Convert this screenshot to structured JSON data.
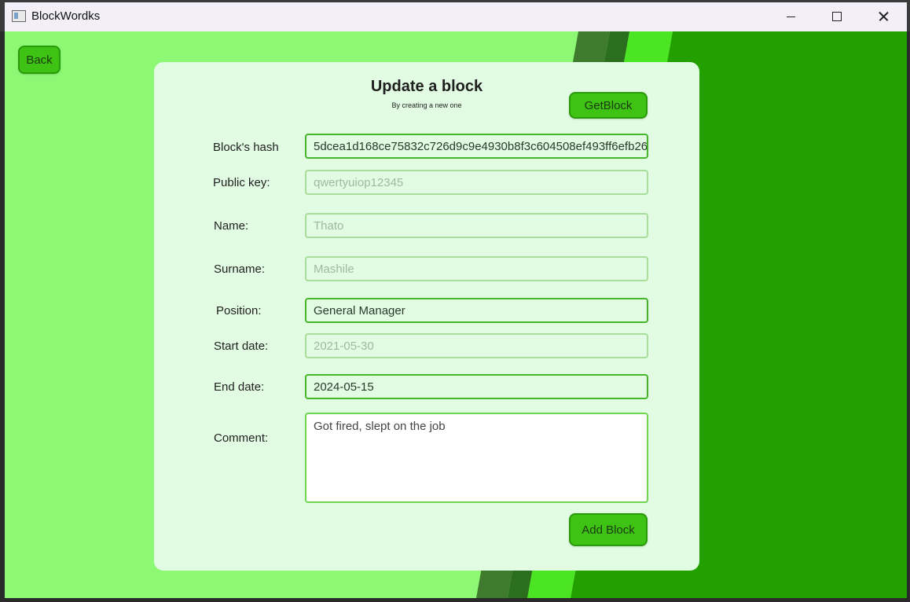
{
  "window": {
    "title": "BlockWordks",
    "controls": [
      "minimize-icon",
      "maximize-icon",
      "close-icon"
    ]
  },
  "colors": {
    "window_bg": "#8cf874",
    "card_bg": "#e1fce3",
    "button_bg": "#3ec314",
    "dark_green": "#23a000",
    "field_border_active": "#46b62b"
  },
  "nav": {
    "back_label": "Back"
  },
  "form": {
    "title": "Update a block",
    "subtitle": "By creating a new one",
    "getblock_label": "GetBlock",
    "submit_label": "Add Block",
    "fields": {
      "hash": {
        "label": "Block's hash",
        "value": "5dcea1d168ce75832c726d9c9e4930b8f3c604508ef493ff6efb26"
      },
      "public_key": {
        "label": "Public key:",
        "placeholder": "qwertyuiop12345"
      },
      "name": {
        "label": "Name:",
        "placeholder": "Thato"
      },
      "surname": {
        "label": "Surname:",
        "placeholder": "Mashile"
      },
      "position": {
        "label": "Position:",
        "value": "General Manager"
      },
      "start_date": {
        "label": "Start date:",
        "placeholder": "2021-05-30"
      },
      "end_date": {
        "label": "End date:",
        "value": "2024-05-15"
      },
      "comment": {
        "label": "Comment:",
        "value": "Got fired, slept on the job"
      }
    }
  }
}
